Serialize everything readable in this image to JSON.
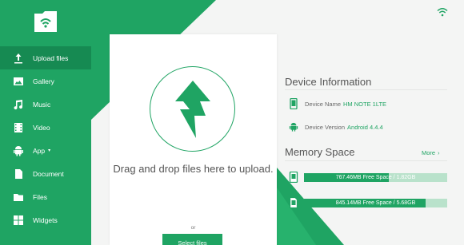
{
  "sidebar": {
    "items": [
      {
        "label": "Upload files",
        "icon": "upload-icon"
      },
      {
        "label": "Gallery",
        "icon": "image-icon"
      },
      {
        "label": "Music",
        "icon": "music-note-icon"
      },
      {
        "label": "Video",
        "icon": "film-icon"
      },
      {
        "label": "App",
        "icon": "android-icon"
      },
      {
        "label": "Document",
        "icon": "document-icon"
      },
      {
        "label": "Files",
        "icon": "folder-icon"
      },
      {
        "label": "Widgets",
        "icon": "widgets-icon"
      }
    ]
  },
  "upload": {
    "title": "Drag and drop files here to upload.",
    "or_text": "or",
    "button_label": "Select files"
  },
  "device": {
    "title": "Device Information",
    "name_label": "Device Name",
    "name_value": "HM NOTE 1LTE",
    "version_label": "Device Version",
    "version_value": "Android 4.4.4"
  },
  "memory": {
    "title": "Memory Space",
    "more_label": "More",
    "items": [
      {
        "label": "767.46MB Free Space / 1.82GB",
        "used_fraction": 0.59,
        "icon": "phone-storage-icon"
      },
      {
        "label": "845.14MB Free Space / 5.68GB",
        "used_fraction": 0.85,
        "icon": "sd-card-icon"
      }
    ]
  },
  "colors": {
    "accent": "#1fa463",
    "accent_dark": "#168a52",
    "bar_track": "#b9e2cb"
  }
}
